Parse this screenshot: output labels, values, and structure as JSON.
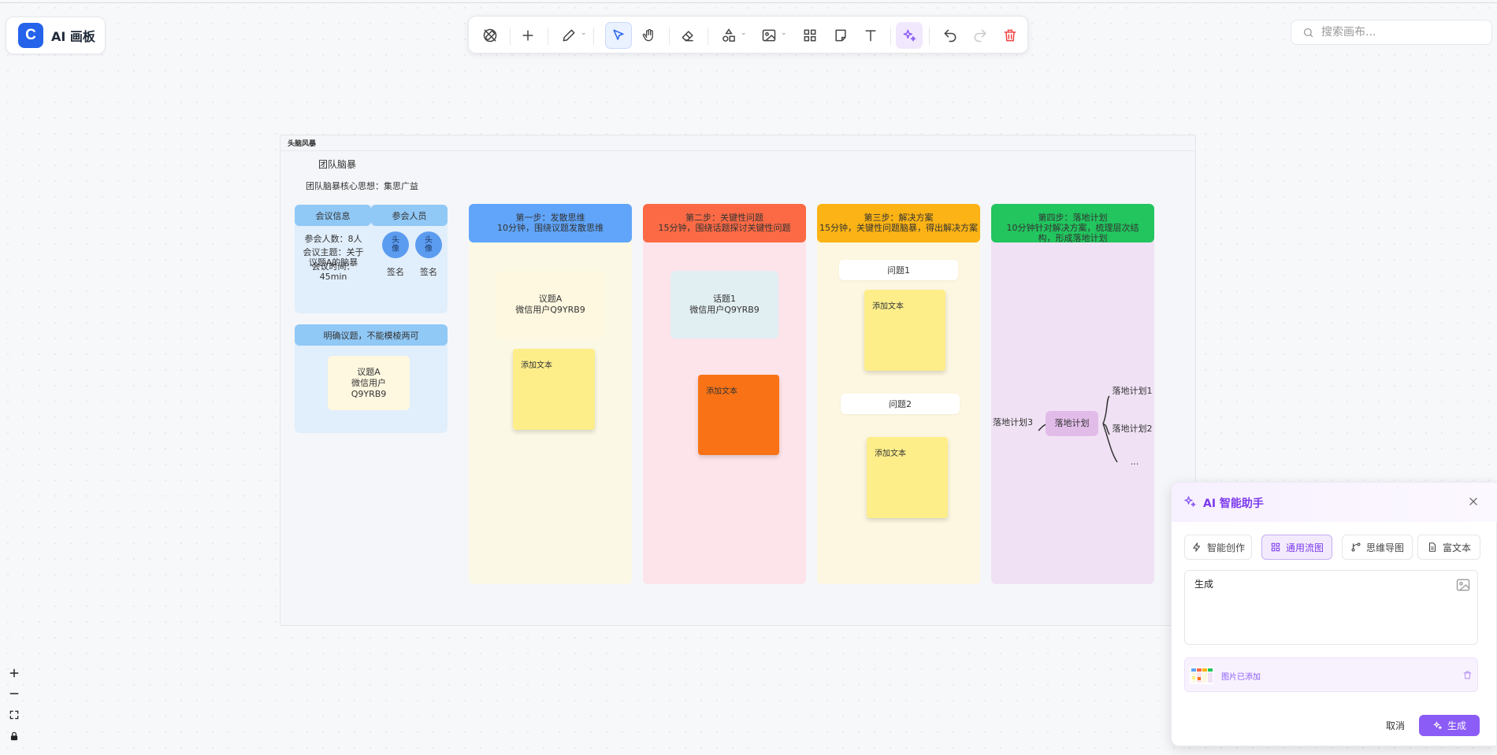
{
  "app": {
    "logo_letter": "C",
    "title": "AI 画板"
  },
  "search": {
    "placeholder": "搜索画布..."
  },
  "frame": {
    "title": "头脑风暴",
    "heading": "团队脑暴",
    "core_idea": "团队脑暴核心思想：集思广益"
  },
  "meeting": {
    "info_header": "会议信息",
    "attendees_header": "参会人员",
    "count": "参会人数：8人",
    "topic": "会议主题：关于议题A的脑暴",
    "duration": "会议时间：45min",
    "avatar_text": "头像",
    "sign_label": "签名"
  },
  "issue": {
    "header": "明确议题，不能模棱两可",
    "card_title": "议题A",
    "card_user": "微信用户Q9YRB9"
  },
  "steps": [
    {
      "title": "第一步：发散思维",
      "desc": "10分钟，围绕议题发散思维"
    },
    {
      "title": "第二步：关键性问题",
      "desc": "15分钟，围绕话题探讨关键性问题"
    },
    {
      "title": "第三步：解决方案",
      "desc": "15分钟，关键性问题脑暴，得出解决方案"
    },
    {
      "title": "第四步：落地计划",
      "desc": "10分钟针对解决方案，梳理层次结构，形成落地计划"
    }
  ],
  "col1": {
    "card_title": "议题A",
    "card_user": "微信用户Q9YRB9",
    "sticky": "添加文本"
  },
  "col2": {
    "card_title": "话题1",
    "card_user": "微信用户Q9YRB9",
    "sticky": "添加文本"
  },
  "col3": {
    "q1": "问题1",
    "q2": "问题2",
    "sticky1": "添加文本",
    "sticky2": "添加文本"
  },
  "col4": {
    "center": "落地计划",
    "left": "落地计划3",
    "right1": "落地计划1",
    "right2": "落地计划2",
    "more": "..."
  },
  "ai": {
    "title": "AI 智能助手",
    "tabs": [
      "智能创作",
      "通用流图",
      "思维导图",
      "富文本"
    ],
    "active_tab": "通用流图",
    "input_value": "生成",
    "image_added": "图片已添加",
    "cancel": "取消",
    "generate": "生成"
  },
  "colors": {
    "brand": "#2563eb",
    "ai_accent": "#8b5cf6",
    "step1": "#60a5fa",
    "step2": "#fb6a45",
    "step3": "#fbb315",
    "step4": "#22c55e"
  },
  "icons": {
    "toolbar": [
      "no-pen-icon",
      "plus-icon",
      "pen-icon",
      "select-cursor-icon",
      "hand-icon",
      "eraser-icon",
      "shapes-icon",
      "image-icon",
      "grid-icon",
      "note-icon",
      "text-icon",
      "ai-sparkle-icon",
      "undo-icon",
      "redo-icon",
      "trash-icon"
    ]
  }
}
